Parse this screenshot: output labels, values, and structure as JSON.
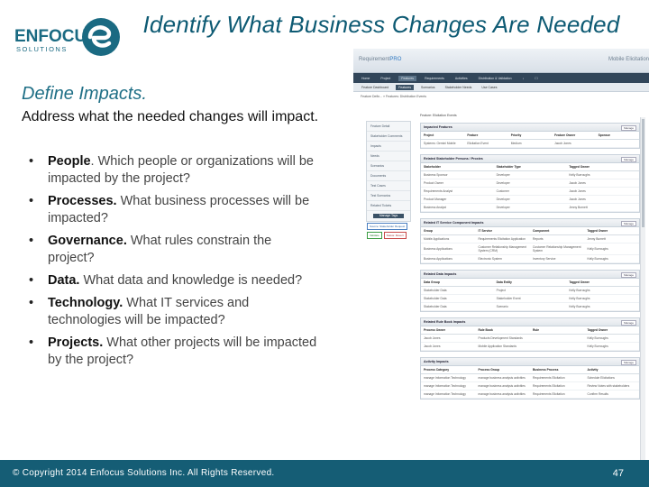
{
  "header": {
    "title": "Identify What Business Changes Are Needed",
    "logo_text": "ENFOCUS",
    "logo_sub": "SOLUTIONS",
    "brand_color": "#1a6a82"
  },
  "content": {
    "subtitle": "Define Impacts.",
    "intro": "Address what the needed changes will impact.",
    "bullets": [
      {
        "term": "People",
        "text": ". Which people or organizations will be impacted by the project?"
      },
      {
        "term": "Processes.",
        "text": " What business processes will be impacted?"
      },
      {
        "term": "Governance.",
        "text": " What rules constrain the project?"
      },
      {
        "term": "Data.",
        "text": " What data and knowledge is needed?"
      },
      {
        "term": "Technology.",
        "text": " What IT services and technologies will be impacted?"
      },
      {
        "term": "Projects.",
        "text": " What other projects will be impacted by the project?"
      }
    ]
  },
  "footer": {
    "copyright": "© Copyright 2014 Enfocus Solutions Inc. All Rights Reserved.",
    "page_number": "47"
  },
  "screenshot": {
    "app_name_1": "Requirement",
    "app_name_2": "PRO",
    "page_name": "Mobile Elicitation",
    "nav": [
      "Home",
      "Project",
      "Features",
      "Requirements",
      "Activities",
      "Distribution & Validation",
      "↓",
      "☐"
    ],
    "nav_active": 2,
    "subnav": [
      "Feature Dashboard",
      "Features",
      "Scenarios",
      "Stakeholder Needs",
      "Use Cases"
    ],
    "subnav_active": 1,
    "crumb": "Feature Defin... » Features: Distribution Events",
    "feature_label": "Feature: Elicitation Events",
    "leftnav": [
      "Feature Detail",
      "Stakeholder Comments",
      "Impacts",
      "Needs",
      "Scenarios",
      "Documents",
      "Test Cases",
      "Test Scenarios",
      "Related Tickets"
    ],
    "leftnav_button": "Manage Tags",
    "tags": [
      "Source: Stakeholder Request",
      "Validate",
      "Status: Revert"
    ],
    "cards": [
      {
        "title": "Impacted Features",
        "more": "Manage",
        "headers": [
          "Project",
          "Feature",
          "Priority",
          "Feature Owner",
          "Sponsor"
        ],
        "rows": [
          [
            "Systems: Gemini Mobile",
            "Elicitation Event",
            "Medium",
            "Jacob Jones",
            ""
          ]
        ]
      },
      {
        "title": "Related Stakeholder Persons / Proxies",
        "more": "Manage",
        "headers": [
          "Stakeholder",
          "Stakeholder Type",
          "Tagged Owner"
        ],
        "rows": [
          [
            "Business Sponsor",
            "Developer",
            "Kelly Burroughs"
          ],
          [
            "Product Owner",
            "Developer",
            "Jacob Jones"
          ],
          [
            "Requirements Analyst",
            "Customer",
            "Jacob Jones"
          ],
          [
            "Product Manager",
            "Developer",
            "Jacob Jones"
          ],
          [
            "Business Analyst",
            "Developer",
            "Jenny Burnett"
          ]
        ]
      },
      {
        "title": "Related IT Service Component Impacts",
        "more": "Manage",
        "headers": [
          "Group",
          "IT Service",
          "Component",
          "Tagged Owner"
        ],
        "rows": [
          [
            "Mobile Applications",
            "Requirements Elicitation Application",
            "Reports",
            "Jenny Burnett"
          ],
          [
            "Business Applications",
            "Customer Relationship Management System (CRM)",
            "Customer Relationship Management System",
            "Kelly Burroughs"
          ],
          [
            "Business Applications",
            "Electronic System",
            "Inventory Service",
            "Kelly Burroughs"
          ]
        ]
      },
      {
        "title": "Related Data Impacts",
        "more": "Manage",
        "headers": [
          "Data Group",
          "Data Entity",
          "Tagged Owner"
        ],
        "rows": [
          [
            "Stakeholder Data",
            "Project",
            "Kelly Burroughs"
          ],
          [
            "Stakeholder Data",
            "Stakeholder Event",
            "Kelly Burroughs"
          ],
          [
            "Stakeholder Data",
            "Scenario",
            "Kelly Burroughs"
          ]
        ]
      },
      {
        "title": "Related Rule Book Impacts",
        "more": "Manage",
        "headers": [
          "Process Owner",
          "Rule Book",
          "Rule",
          "Tagged Owner"
        ],
        "rows": [
          [
            "Jacob Jones",
            "Products Development Standards",
            "",
            "Kelly Burroughs"
          ],
          [
            "Jacob Jones",
            "Mobile Application Standards",
            "",
            "Kelly Burroughs"
          ]
        ]
      },
      {
        "title": "Activity Impacts",
        "more": "Manage",
        "headers": [
          "Process Category",
          "Process Group",
          "Business Process",
          "Activity"
        ],
        "rows": [
          [
            "manage Information Technology",
            "manage business analysis activities",
            "Requirements Elicitation",
            "Schedule Elicitations"
          ],
          [
            "manage Information Technology",
            "manage business analysis activities",
            "Requirements Elicitation",
            "Review Notes with stakeholders"
          ],
          [
            "manage Information Technology",
            "manage business analysis activities",
            "Requirements Elicitation",
            "Confirm Results"
          ]
        ]
      }
    ]
  }
}
